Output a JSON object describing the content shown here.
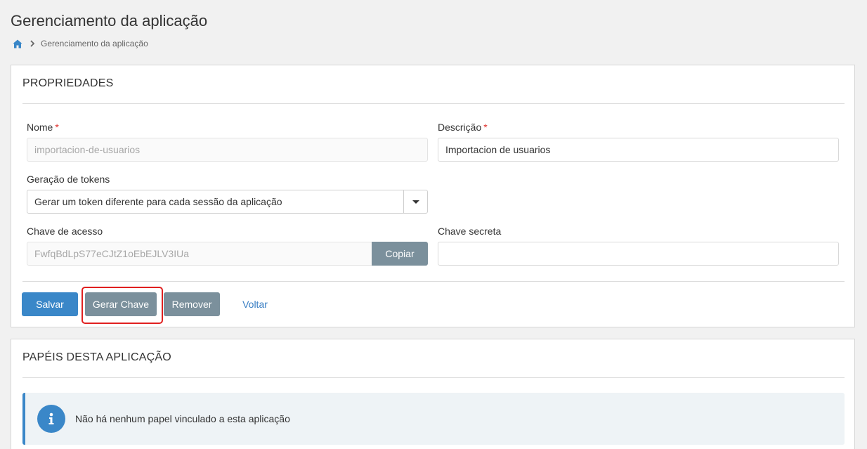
{
  "page": {
    "title": "Gerenciamento da aplicação",
    "breadcrumb_current": "Gerenciamento da aplicação"
  },
  "props": {
    "heading": "PROPRIEDADES",
    "name_label": "Nome",
    "name_required": "*",
    "name_value": "importacion-de-usuarios",
    "desc_label": "Descrição",
    "desc_required": "*",
    "desc_value": "Importacion de usuarios",
    "token_label": "Geração de tokens",
    "token_value": "Gerar um token diferente para cada sessão da aplicação",
    "access_key_label": "Chave de acesso",
    "access_key_value": "FwfqBdLpS77eCJtZ1oEbEJLV3IUa",
    "copy_label": "Copiar",
    "secret_key_label": "Chave secreta",
    "secret_key_value": ""
  },
  "actions": {
    "save": "Salvar",
    "generate_key": "Gerar Chave",
    "remove": "Remover",
    "back": "Voltar"
  },
  "roles": {
    "heading": "PAPÉIS DESTA APLICAÇÃO",
    "empty_message": "Não há nenhum papel vinculado a esta aplicação"
  },
  "colors": {
    "primary": "#3a87c8",
    "gray_button": "#7b909c",
    "required": "#e0322d",
    "highlight": "#e02020"
  },
  "icons": {
    "home": "home-icon",
    "breadcrumb_separator": "chevron-right-icon",
    "select_caret": "caret-down-icon",
    "info": "info-icon"
  }
}
